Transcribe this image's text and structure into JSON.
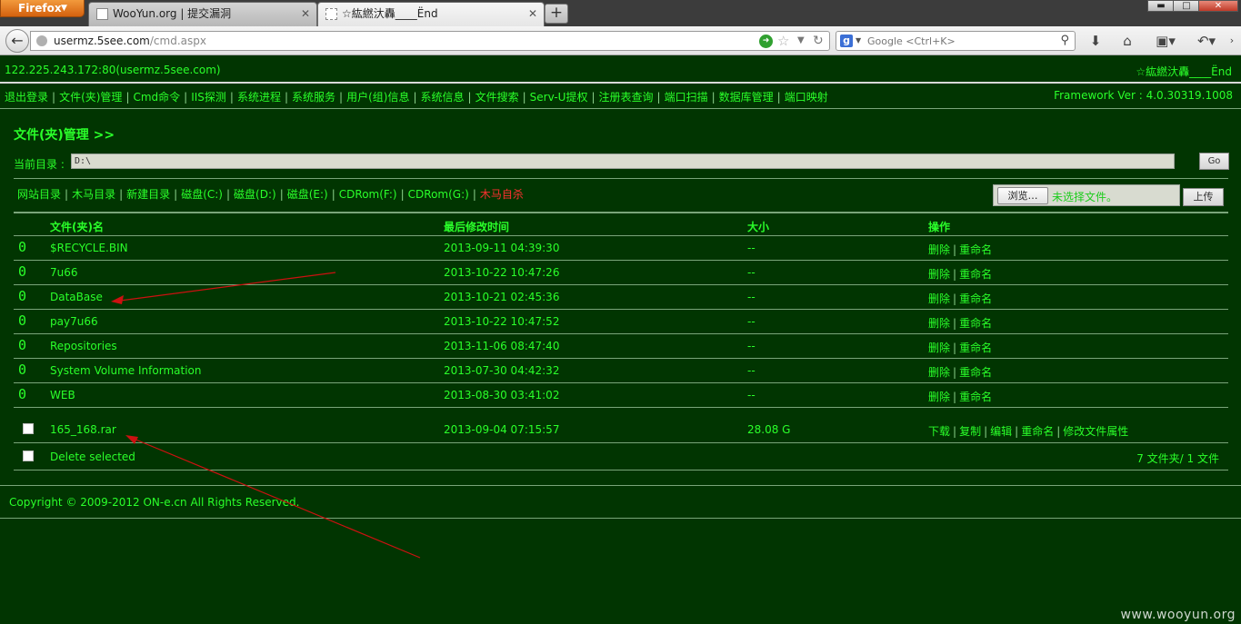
{
  "browser": {
    "menu_button": "Firefox",
    "tabs": [
      {
        "title": "WooYun.org | 提交漏洞"
      },
      {
        "title": "☆紘繎汏轟____Ёnd"
      }
    ],
    "url_host": "usermz.5see.com",
    "url_path": "/cmd.aspx",
    "search_placeholder": "Google <Ctrl+K>"
  },
  "header": {
    "host": "122.225.243.172:80(usermz.5see.com)",
    "signature": "☆紘繎汏轟____Ёnd",
    "framework": "Framework Ver : 4.0.30319.1008"
  },
  "menu": [
    "退出登录",
    "文件(夹)管理",
    "Cmd命令",
    "IIS探测",
    "系统进程",
    "系统服务",
    "用户(组)信息",
    "系统信息",
    "文件搜索",
    "Serv-U提权",
    "注册表查询",
    "端口扫描",
    "数据库管理",
    "端口映射"
  ],
  "main": {
    "title": "文件(夹)管理 >>",
    "current_dir_label": "当前目录 :",
    "current_dir": "D:\\",
    "go_label": "Go",
    "quicklinks": [
      "网站目录",
      "木马目录",
      "新建目录",
      "磁盘(C:)",
      "磁盘(D:)",
      "磁盘(E:)",
      "CDRom(F:)",
      "CDRom(G:)"
    ],
    "self_kill": "木马自杀",
    "browse_label": "浏览…",
    "no_file": "未选择文件。",
    "upload_label": "上传",
    "columns": {
      "name": "文件(夹)名",
      "modified": "最后修改时间",
      "size": "大小",
      "actions": "操作"
    },
    "folder_icon": "0",
    "folders": [
      {
        "name": "$RECYCLE.BIN",
        "modified": "2013-09-11 04:39:30",
        "size": "--"
      },
      {
        "name": "7u66",
        "modified": "2013-10-22 10:47:26",
        "size": "--"
      },
      {
        "name": "DataBase",
        "modified": "2013-10-21 02:45:36",
        "size": "--"
      },
      {
        "name": "pay7u66",
        "modified": "2013-10-22 10:47:52",
        "size": "--"
      },
      {
        "name": "Repositories",
        "modified": "2013-11-06 08:47:40",
        "size": "--"
      },
      {
        "name": "System Volume Information",
        "modified": "2013-07-30 04:42:32",
        "size": "--"
      },
      {
        "name": "WEB",
        "modified": "2013-08-30 03:41:02",
        "size": "--"
      }
    ],
    "folder_actions": {
      "delete": "删除",
      "rename": "重命名"
    },
    "file": {
      "name": "165_168.rar",
      "modified": "2013-09-04 07:15:57",
      "size": "28.08 G",
      "actions": [
        "下载",
        "复制",
        "编辑",
        "重命名",
        "修改文件属性"
      ]
    },
    "delete_selected": "Delete selected",
    "summary": "7 文件夹/ 1 文件"
  },
  "footer": {
    "copyright": "Copyright © 2009-2012 ON-e.cn All Rights Reserved."
  },
  "watermark": "www.wooyun.org",
  "colors": {
    "background": "#013501",
    "text": "#2aff2a",
    "danger": "#ff3030",
    "annotation": "#cc1111"
  }
}
